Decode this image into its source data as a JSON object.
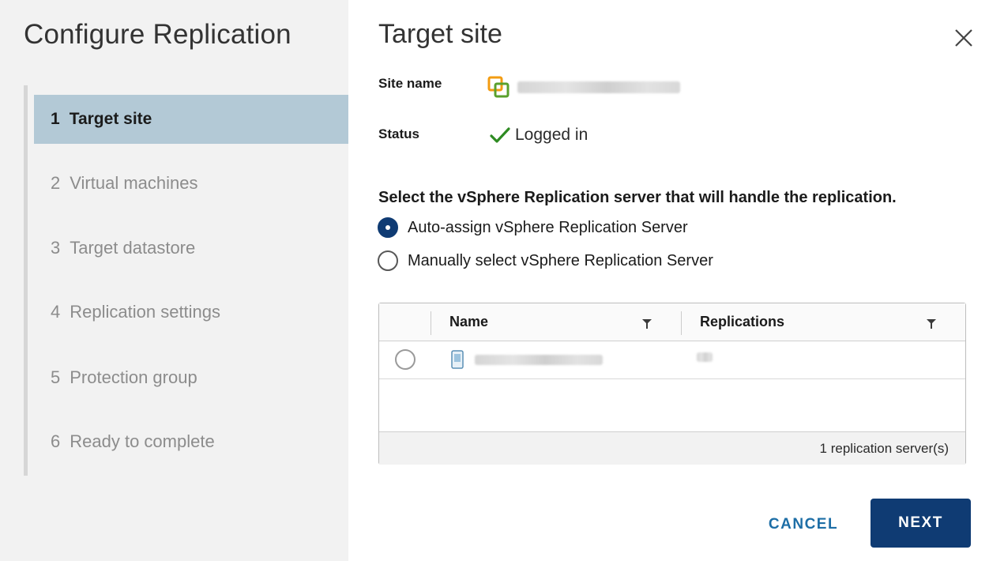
{
  "wizard": {
    "title": "Configure Replication",
    "steps": [
      {
        "num": "1",
        "label": "Target site",
        "active": true
      },
      {
        "num": "2",
        "label": "Virtual machines",
        "active": false
      },
      {
        "num": "3",
        "label": "Target datastore",
        "active": false
      },
      {
        "num": "4",
        "label": "Replication settings",
        "active": false
      },
      {
        "num": "5",
        "label": "Protection group",
        "active": false
      },
      {
        "num": "6",
        "label": "Ready to complete",
        "active": false
      }
    ]
  },
  "page": {
    "title": "Target site",
    "close_icon": "close-icon"
  },
  "site": {
    "label": "Site name",
    "icon": "vcenter-site-icon",
    "value_blurred": true
  },
  "status": {
    "label": "Status",
    "value": "Logged in",
    "icon": "checkmark-icon",
    "icon_color": "#2e8b22"
  },
  "selection": {
    "prompt": "Select the vSphere Replication server that will handle the replication.",
    "options": [
      {
        "label": "Auto-assign vSphere Replication Server",
        "checked": true
      },
      {
        "label": "Manually select vSphere Replication Server",
        "checked": false
      }
    ]
  },
  "table": {
    "columns": [
      "Name",
      "Replications"
    ],
    "filter_icon": "filter-icon",
    "rows": [
      {
        "name_blurred": true,
        "replications_blurred": true,
        "icon": "server-icon",
        "selected": false
      }
    ],
    "footer": "1 replication server(s)"
  },
  "actions": {
    "cancel": "CANCEL",
    "next": "NEXT"
  },
  "colors": {
    "active_step_bg": "#b3c9d6",
    "primary": "#0f3b73",
    "link": "#1d6ea6",
    "site_icon_orange": "#f39c12",
    "site_icon_green": "#5aa02c"
  }
}
